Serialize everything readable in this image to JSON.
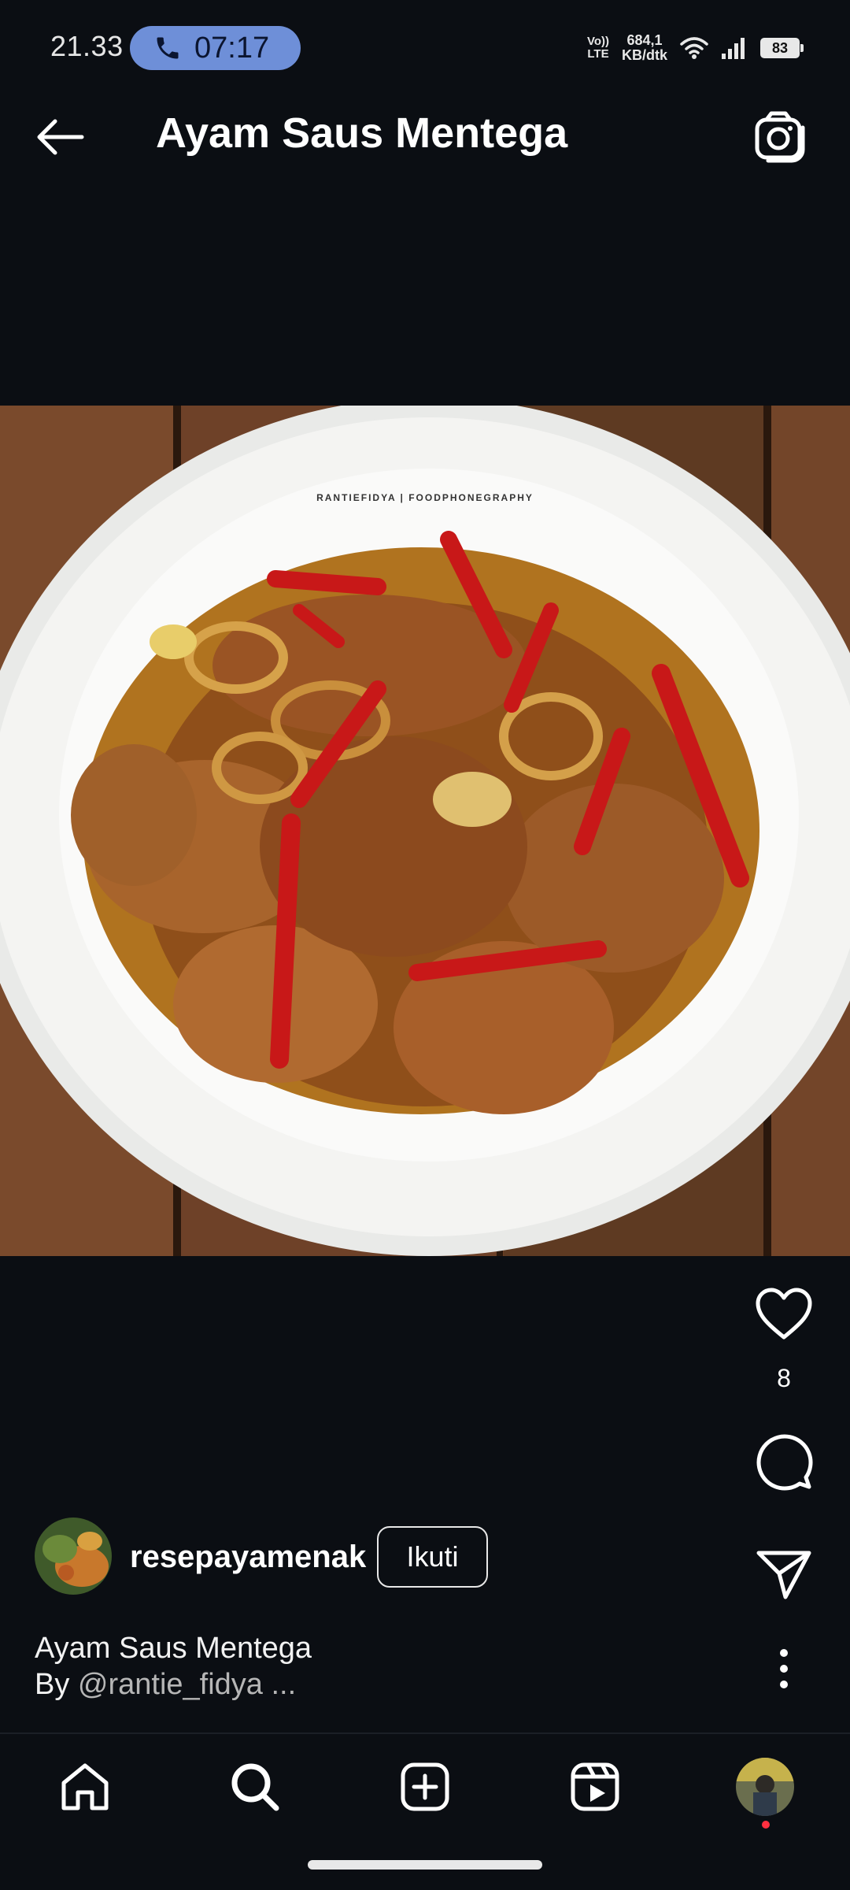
{
  "status_bar": {
    "time": "21.33",
    "call_timer": "07:17",
    "volte_line1": "Vo))",
    "volte_line2": "LTE",
    "net_speed_value": "684,1",
    "net_speed_unit": "KB/dtk",
    "battery": "83"
  },
  "header": {
    "title": "Ayam Saus Mentega",
    "back_icon": "arrow-left-icon",
    "camera_icon": "camera-icon"
  },
  "post": {
    "watermark": "RANTIEFIDYA | FOODPHONEGRAPHY",
    "like_count": "8",
    "username": "resepayamenak",
    "follow_label": "Ikuti",
    "caption_line1": "Ayam Saus Mentega",
    "caption_by": "By ",
    "caption_handle": "@rantie_fidya ..."
  },
  "colors": {
    "background": "#0b0e13",
    "call_pill": "#6e8fd8",
    "notification_dot": "#ff3040",
    "text": "#ffffff"
  },
  "nav": {
    "items": [
      "home-icon",
      "search-icon",
      "add-icon",
      "reels-icon",
      "profile-avatar"
    ]
  }
}
